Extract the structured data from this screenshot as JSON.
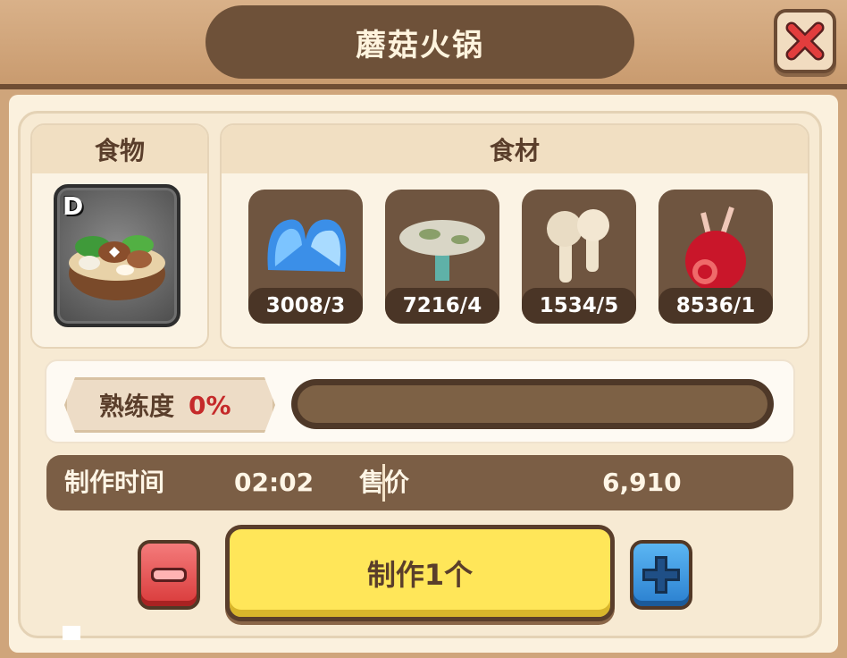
{
  "title": "蘑菇火锅",
  "food_section": {
    "header": "食物",
    "grade": "D",
    "icon": "mushroom-hotpot-icon"
  },
  "ingredients_section": {
    "header": "食材",
    "items": [
      {
        "icon": "blue-crystal-icon",
        "count": "3008/3"
      },
      {
        "icon": "mushroom-cap-icon",
        "count": "7216/4"
      },
      {
        "icon": "white-mushrooms-icon",
        "count": "1534/5"
      },
      {
        "icon": "red-fruit-icon",
        "count": "8536/1"
      }
    ]
  },
  "mastery": {
    "label": "熟练度",
    "value": "0%",
    "progress": 0
  },
  "info": {
    "time_label": "制作时间",
    "time_value": "02:02",
    "price_label": "售价",
    "price_value": "6,910"
  },
  "actions": {
    "make_label": "制作1个"
  },
  "colors": {
    "accent_yellow": "#ffe659",
    "frame_brown": "#6e5139",
    "mastery_red": "#c52a2a"
  }
}
